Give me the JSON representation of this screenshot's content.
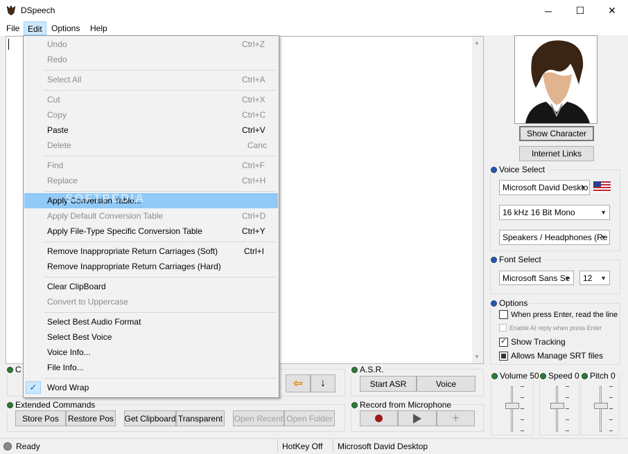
{
  "window": {
    "title": "DSpeech",
    "minimize": "─",
    "maximize": "☐",
    "close": "✕"
  },
  "menubar": [
    "File",
    "Edit",
    "Options",
    "Help"
  ],
  "edit_menu": [
    {
      "label": "Undo",
      "shortcut": "Ctrl+Z",
      "enabled": false
    },
    {
      "label": "Redo",
      "shortcut": "",
      "enabled": false
    },
    {
      "label": "Select All",
      "shortcut": "Ctrl+A",
      "enabled": false
    },
    {
      "label": "Cut",
      "shortcut": "Ctrl+X",
      "enabled": false
    },
    {
      "label": "Copy",
      "shortcut": "Ctrl+C",
      "enabled": false
    },
    {
      "label": "Paste",
      "shortcut": "Ctrl+V",
      "enabled": true
    },
    {
      "label": "Delete",
      "shortcut": "Canc",
      "enabled": false
    },
    {
      "label": "Find",
      "shortcut": "Ctrl+F",
      "enabled": false
    },
    {
      "label": "Replace",
      "shortcut": "Ctrl+H",
      "enabled": false
    },
    {
      "label": "Apply Conversion Table...",
      "shortcut": "",
      "enabled": true,
      "highlighted": true
    },
    {
      "label": "Apply Default Conversion Table",
      "shortcut": "Ctrl+D",
      "enabled": false
    },
    {
      "label": "Apply File-Type Specific Conversion Table",
      "shortcut": "Ctrl+Y",
      "enabled": true
    },
    {
      "label": "Remove Inappropriate Return Carriages (Soft)",
      "shortcut": "Ctrl+I",
      "enabled": true
    },
    {
      "label": "Remove Inappropriate Return Carriages (Hard)",
      "shortcut": "",
      "enabled": true
    },
    {
      "label": "Clear ClipBoard",
      "shortcut": "",
      "enabled": true
    },
    {
      "label": "Convert to Uppercase",
      "shortcut": "",
      "enabled": false
    },
    {
      "label": "Select Best Audio Format",
      "shortcut": "",
      "enabled": true
    },
    {
      "label": "Select Best Voice",
      "shortcut": "",
      "enabled": true
    },
    {
      "label": "Voice Info...",
      "shortcut": "",
      "enabled": true
    },
    {
      "label": "File Info...",
      "shortcut": "",
      "enabled": true
    },
    {
      "label": "Word Wrap",
      "shortcut": "",
      "enabled": true,
      "checked": true
    }
  ],
  "character": {
    "show_button": "Show Character",
    "links_button": "Internet Links"
  },
  "voice_select": {
    "label": "Voice Select",
    "voice": "Microsoft David Deskto",
    "format": "16 kHz 16 Bit Mono",
    "output": "Speakers / Headphones (Re"
  },
  "font_select": {
    "label": "Font Select",
    "font": "Microsoft Sans Se",
    "size": "12"
  },
  "options": {
    "label": "Options",
    "items": [
      {
        "label": "When press Enter, read the line",
        "checked": false,
        "enabled": true
      },
      {
        "label": "Enable AI reply when press Enter",
        "checked": false,
        "enabled": false
      },
      {
        "label": "Show Tracking",
        "checked": true,
        "enabled": true
      },
      {
        "label": "Allows Manage SRT files",
        "checked": true,
        "enabled": true
      }
    ]
  },
  "sliders": {
    "volume": "Volume 50",
    "speed": "Speed 0",
    "pitch": "Pitch 0"
  },
  "commands": {
    "label_partial": "C"
  },
  "asr": {
    "label": "A.S.R.",
    "start": "Start ASR",
    "voice": "Voice"
  },
  "extended": {
    "label": "Extended Commands",
    "buttons": [
      "Store Pos",
      "Restore Pos",
      "Get Clipboard",
      "Transparent",
      "Open Recent",
      "Open Folder"
    ]
  },
  "record": {
    "label": "Record from Microphone"
  },
  "status": {
    "state": "Ready",
    "hotkey": "HotKey Off",
    "voice": "Microsoft David Desktop"
  },
  "watermark": "SOFTPEDIA",
  "colors": {
    "highlight": "#91c9f7",
    "record": "#a01818"
  }
}
